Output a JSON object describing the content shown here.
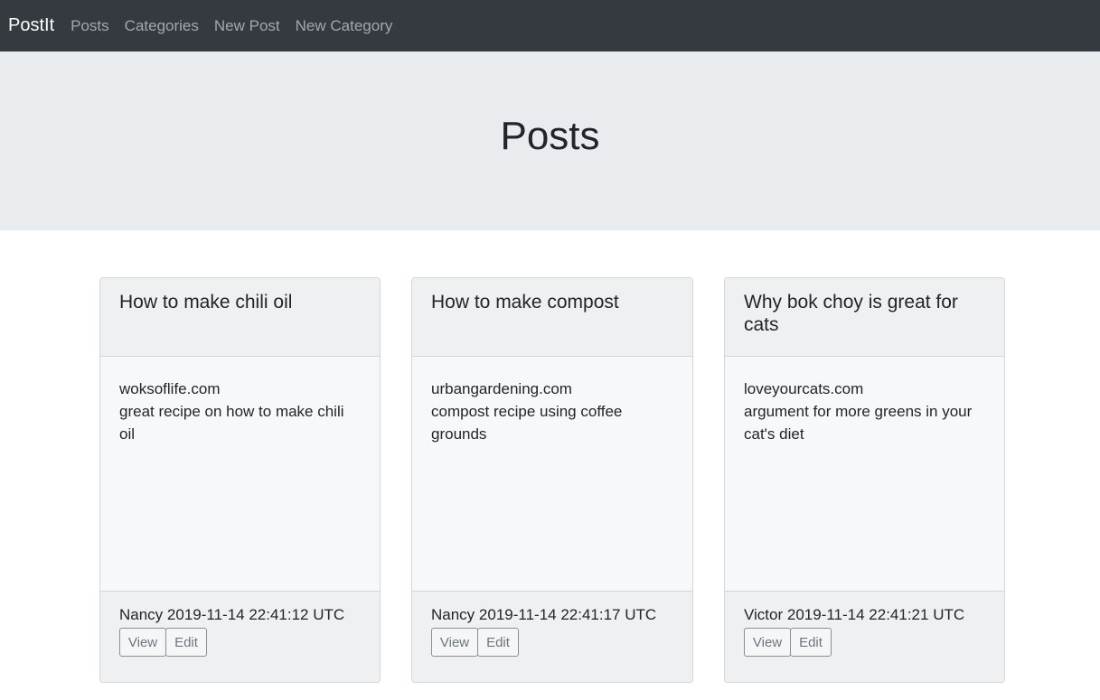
{
  "navbar": {
    "brand": "PostIt",
    "links": [
      "Posts",
      "Categories",
      "New Post",
      "New Category"
    ]
  },
  "jumbotron": {
    "title": "Posts"
  },
  "posts": [
    {
      "title": "How to make chili oil",
      "url": "woksoflife.com",
      "description": "great recipe on how to make chili oil",
      "meta": "Nancy 2019-11-14 22:41:12 UTC",
      "view_label": "View",
      "edit_label": "Edit"
    },
    {
      "title": "How to make compost",
      "url": "urbangardening.com",
      "description": "compost recipe using coffee grounds",
      "meta": "Nancy 2019-11-14 22:41:17 UTC",
      "view_label": "View",
      "edit_label": "Edit"
    },
    {
      "title": "Why bok choy is great for cats",
      "url": "loveyourcats.com",
      "description": "argument for more greens in your cat's diet",
      "meta": "Victor 2019-11-14 22:41:21 UTC",
      "view_label": "View",
      "edit_label": "Edit"
    }
  ]
}
